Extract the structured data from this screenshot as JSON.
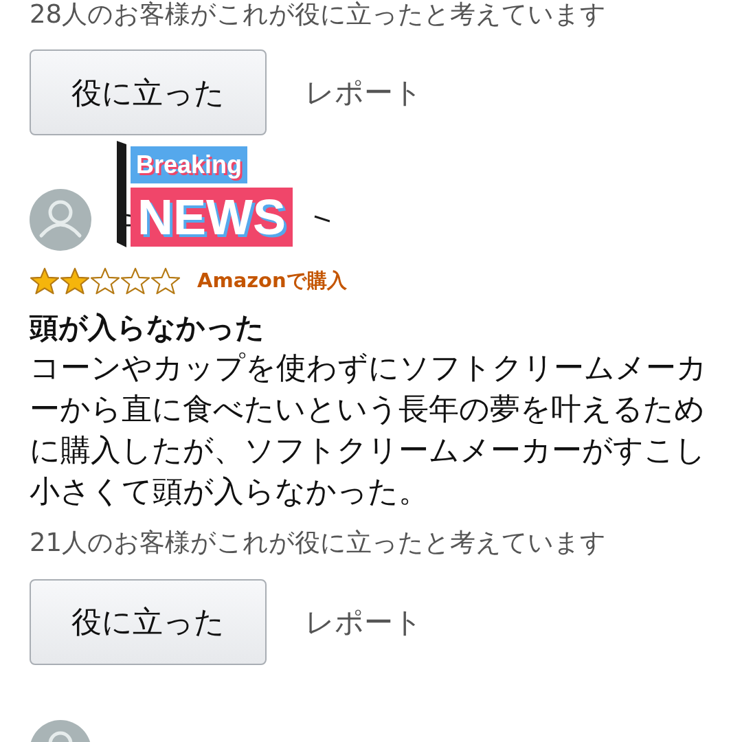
{
  "previous_review": {
    "helpful_count": "28人のお客様がこれが役に立ったと考えています",
    "helpful_button": "役に立った",
    "report_link": "レポート"
  },
  "review": {
    "sticker": {
      "line1": "Breaking",
      "line2": "NEWS"
    },
    "stars": 2,
    "badge": "Amazonで購入",
    "title": "頭が入らなかった",
    "body": "コーンやカップを使わずにソフトクリームメーカーから直に食べたいという長年の夢を叶えるために購入したが、ソフトクリームメーカーがすこし小さくて頭が入らなかった。",
    "helpful_count": "21人のお客様がこれが役に立ったと考えています",
    "helpful_button": "役に立った",
    "report_link": "レポート"
  }
}
